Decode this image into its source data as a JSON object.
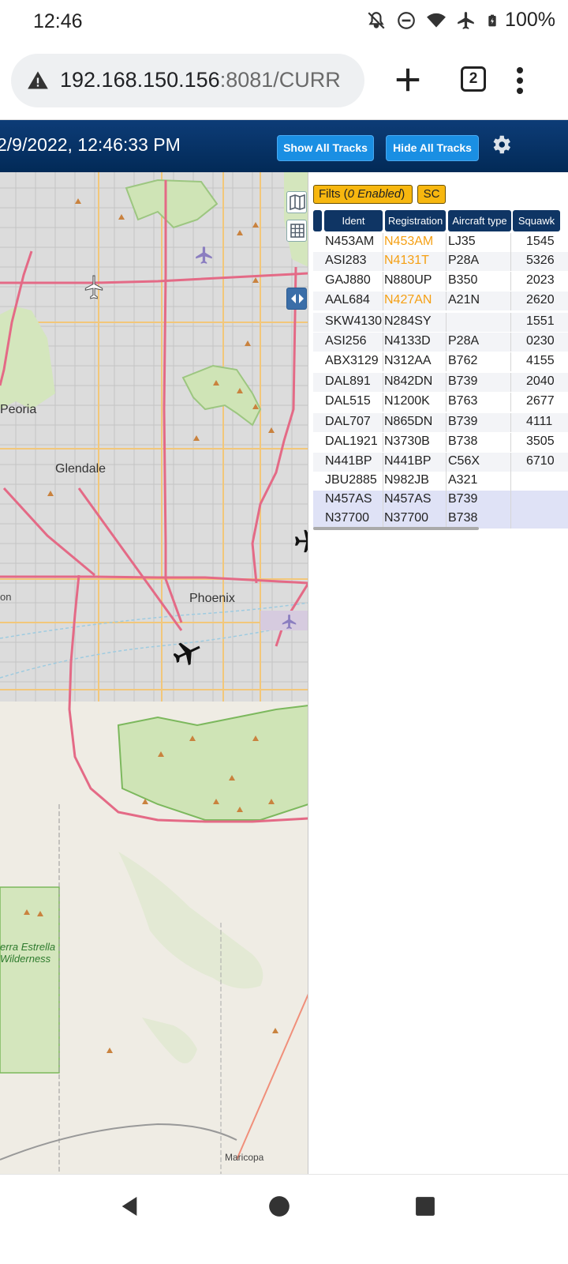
{
  "status_bar": {
    "time": "12:46",
    "battery": "100%",
    "icons": [
      "bell-off-icon",
      "do-not-disturb-icon",
      "wifi-icon",
      "airplane-icon",
      "battery-charging-icon"
    ]
  },
  "browser": {
    "url_host": "192.168.150.156",
    "url_rest": ":8081/CURR",
    "tab_count": "2"
  },
  "header": {
    "datetime": "2/9/2022, 12:46:33 PM",
    "show_all_label": "Show All Tracks",
    "hide_all_label": "Hide All Tracks"
  },
  "map": {
    "labels": {
      "peoria": "Peoria",
      "glendale": "Glendale",
      "phoenix": "Phoenix",
      "maricopa": "Maricopa",
      "sierra_estrella": "erra Estrella\nWilderness",
      "on": "on"
    }
  },
  "panel": {
    "filters_prefix": "Filts (",
    "filters_count": "0 Enabled",
    "filters_suffix": ")",
    "sc_label": "SC",
    "columns": [
      "Ident",
      "Registration",
      "Aircraft type",
      "Squawk"
    ],
    "rows": [
      {
        "ident": "N453AM",
        "reg": "N453AM",
        "type": "LJ35",
        "squawk": "1545",
        "reg_highlight": true
      },
      {
        "ident": "ASI283",
        "reg": "N4131T",
        "type": "P28A",
        "squawk": "5326",
        "reg_highlight": true
      },
      {
        "ident": "GAJ880",
        "reg": "N880UP",
        "type": "B350",
        "squawk": "2023",
        "reg_highlight": false
      },
      {
        "ident": "AAL684",
        "reg": "N427AN",
        "type": "A21N",
        "squawk": "2620",
        "reg_highlight": true
      },
      {
        "ident": "SKW4130",
        "reg": "N284SY",
        "type": "",
        "squawk": "1551",
        "reg_highlight": false
      },
      {
        "ident": "ASI256",
        "reg": "N4133D",
        "type": "P28A",
        "squawk": "0230",
        "reg_highlight": false
      },
      {
        "ident": "ABX3129",
        "reg": "N312AA",
        "type": "B762",
        "squawk": "4155",
        "reg_highlight": false
      },
      {
        "ident": "DAL891",
        "reg": "N842DN",
        "type": "B739",
        "squawk": "2040",
        "reg_highlight": false
      },
      {
        "ident": "DAL515",
        "reg": "N1200K",
        "type": "B763",
        "squawk": "2677",
        "reg_highlight": false
      },
      {
        "ident": "DAL707",
        "reg": "N865DN",
        "type": "B739",
        "squawk": "4111",
        "reg_highlight": false
      },
      {
        "ident": "DAL1921",
        "reg": "N3730B",
        "type": "B738",
        "squawk": "3505",
        "reg_highlight": false
      },
      {
        "ident": "N441BP",
        "reg": "N441BP",
        "type": "C56X",
        "squawk": "6710",
        "reg_highlight": false
      },
      {
        "ident": "JBU2885",
        "reg": "N982JB",
        "type": "A321",
        "squawk": "",
        "reg_highlight": false
      },
      {
        "ident": "N457AS",
        "reg": "N457AS",
        "type": "B739",
        "squawk": "",
        "reg_highlight": false
      },
      {
        "ident": "N37700",
        "reg": "N37700",
        "type": "B738",
        "squawk": "",
        "reg_highlight": false
      }
    ]
  },
  "colors": {
    "header_bg": "#022a57",
    "button_blue": "#1a8fe3",
    "chip_yellow": "#f7b70f",
    "reg_orange": "#f5a014",
    "column_header": "#0f3564"
  }
}
